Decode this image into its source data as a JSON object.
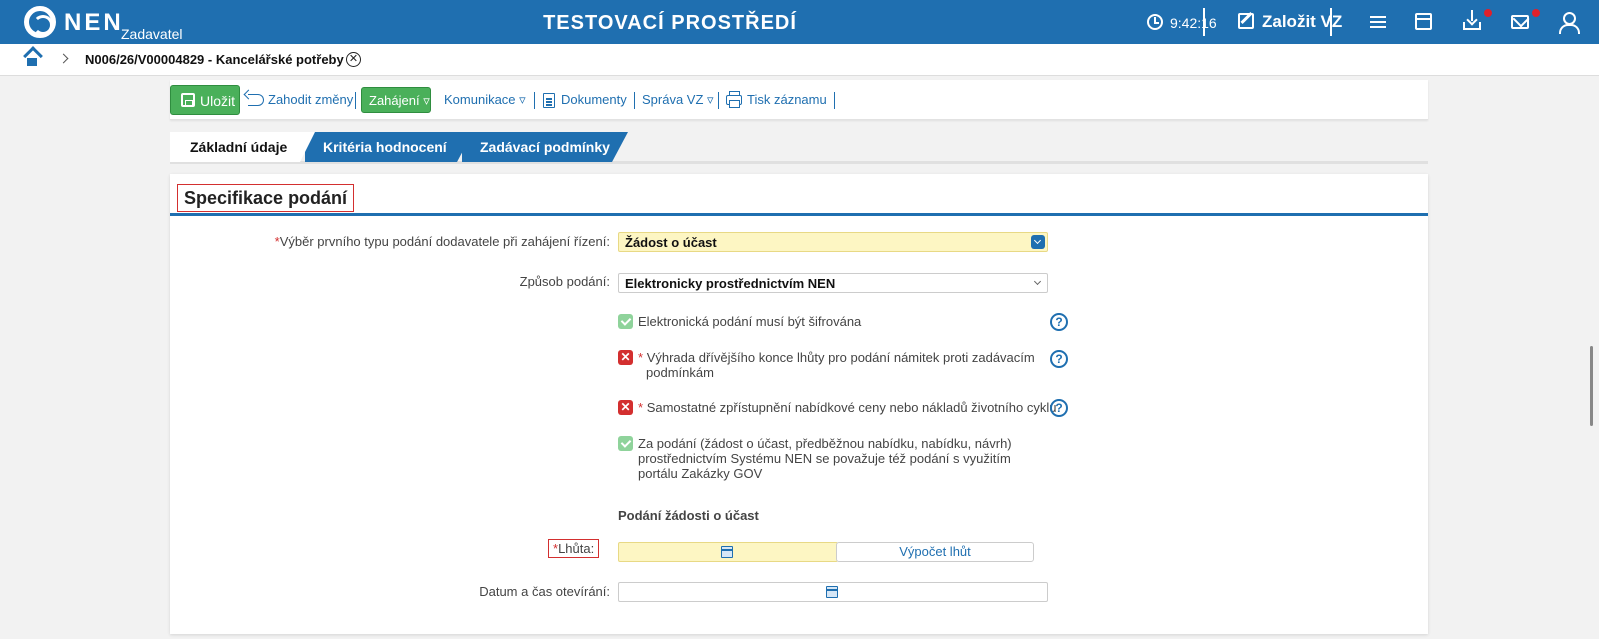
{
  "header": {
    "brand": "NEN",
    "brand_sub": "Zadavatel",
    "env_title": "TESTOVACÍ PROSTŘEDÍ",
    "time": "9:42:16",
    "create_vz": "Založit VZ"
  },
  "breadcrumb": {
    "text": "N006/26/V00004829 - Kancelářské potřeby",
    "close_glyph": "✕"
  },
  "toolbar": {
    "save": "Uložit",
    "discard": "Zahodit změny",
    "start": "Zahájení ▿",
    "communication": "Komunikace ▿",
    "documents": "Dokumenty",
    "manage": "Správa VZ ▿",
    "print": "Tisk záznamu"
  },
  "tabs": [
    "Základní údaje",
    "Kritéria hodnocení",
    "Zadávací podmínky"
  ],
  "section_title": "Specifikace podání",
  "form": {
    "first_type_label": "Výběr prvního typu podání dodavatele při zahájení řízení:",
    "first_type_value": "Žádost o účast",
    "method_label": "Způsob podání:",
    "method_value": "Elektronicky prostřednictvím NEN",
    "checks": [
      {
        "state": "ok",
        "text": "Elektronická podání musí být šifrována",
        "required": false,
        "help": true
      },
      {
        "state": "no",
        "text": "Výhrada dřívějšího konce lhůty pro podání námitek proti zadávacím",
        "text2": "podmínkám",
        "required": true,
        "help": true
      },
      {
        "state": "no",
        "text": "Samostatné zpřístupnění nabídkové ceny nebo nákladů životního cyklu",
        "required": true,
        "help": true
      },
      {
        "state": "ok",
        "text": "Za podání (žádost o účast, předběžnou nabídku, nabídku, návrh) prostřednictvím Systému NEN se považuje též podání s využitím portálu Zakázky GOV",
        "required": false,
        "help": false
      }
    ],
    "subsection": "Podání žádosti o účast",
    "deadline_label": "Lhůta:",
    "calc_button": "Výpočet lhůt",
    "opening_label": "Datum a čas otevírání:",
    "required_mark": "*",
    "help_glyph": "?",
    "no_glyph": "✕"
  },
  "colors": {
    "primary": "#1f6fb0",
    "success": "#4ab05a",
    "required": "#d32f2f",
    "highlight": "#fdf6c3"
  }
}
